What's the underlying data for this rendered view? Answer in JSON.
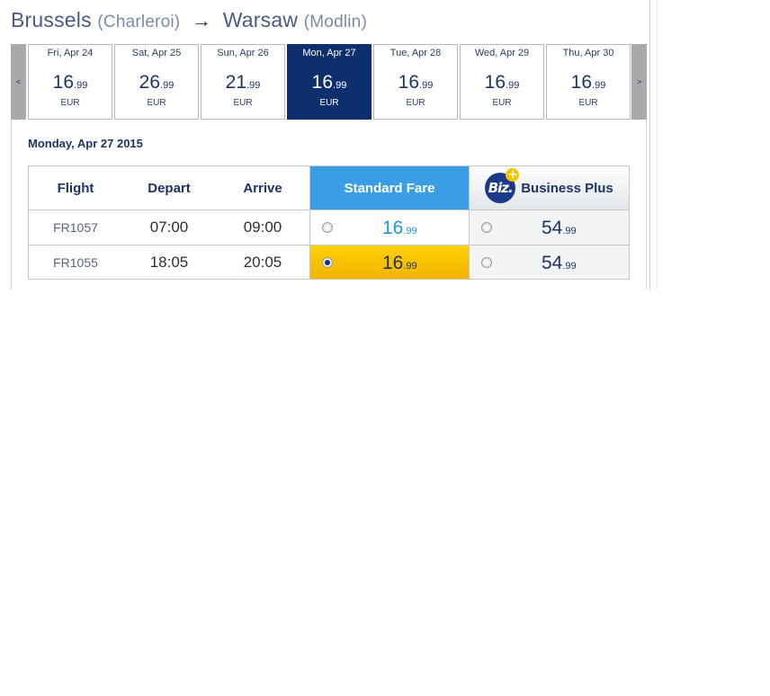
{
  "route": {
    "origin_city": "Brussels",
    "origin_airport": "(Charleroi)",
    "arrow": "→",
    "dest_city": "Warsaw",
    "dest_airport": "(Modlin)"
  },
  "calendar": {
    "prev_label": "<",
    "next_label": ">",
    "days": [
      {
        "date": "Fri, Apr 24",
        "price_main": "16",
        "price_cents": ".99",
        "currency": "EUR"
      },
      {
        "date": "Sat, Apr 25",
        "price_main": "26",
        "price_cents": ".99",
        "currency": "EUR"
      },
      {
        "date": "Sun, Apr 26",
        "price_main": "21",
        "price_cents": ".99",
        "currency": "EUR"
      },
      {
        "date": "Mon, Apr 27",
        "price_main": "16",
        "price_cents": ".99",
        "currency": "EUR"
      },
      {
        "date": "Tue, Apr 28",
        "price_main": "16",
        "price_cents": ".99",
        "currency": "EUR"
      },
      {
        "date": "Wed, Apr 29",
        "price_main": "16",
        "price_cents": ".99",
        "currency": "EUR"
      },
      {
        "date": "Thu, Apr 30",
        "price_main": "16",
        "price_cents": ".99",
        "currency": "EUR"
      }
    ]
  },
  "selected_date": "Monday, Apr 27 2015",
  "table": {
    "headers": {
      "flight": "Flight",
      "depart": "Depart",
      "arrive": "Arrive",
      "standard": "Standard Fare",
      "biz_badge": "Biz.",
      "biz_plus_sign": "+",
      "business": "Business Plus"
    },
    "rows": [
      {
        "flight": "FR1057",
        "depart": "07:00",
        "arrive": "09:00",
        "std_main": "16",
        "std_cents": ".99",
        "biz_main": "54",
        "biz_cents": ".99"
      },
      {
        "flight": "FR1055",
        "depart": "18:05",
        "arrive": "20:05",
        "std_main": "16",
        "std_cents": ".99",
        "biz_main": "54",
        "biz_cents": ".99"
      }
    ]
  },
  "colors": {
    "accent_blue": "#3a9ee4",
    "navy": "#0d2f6e",
    "selected_fare": "#ffd200"
  },
  "icons": {
    "prev": "chevron-left-icon",
    "next": "chevron-right-icon",
    "biz": "business-plus-badge-icon"
  }
}
